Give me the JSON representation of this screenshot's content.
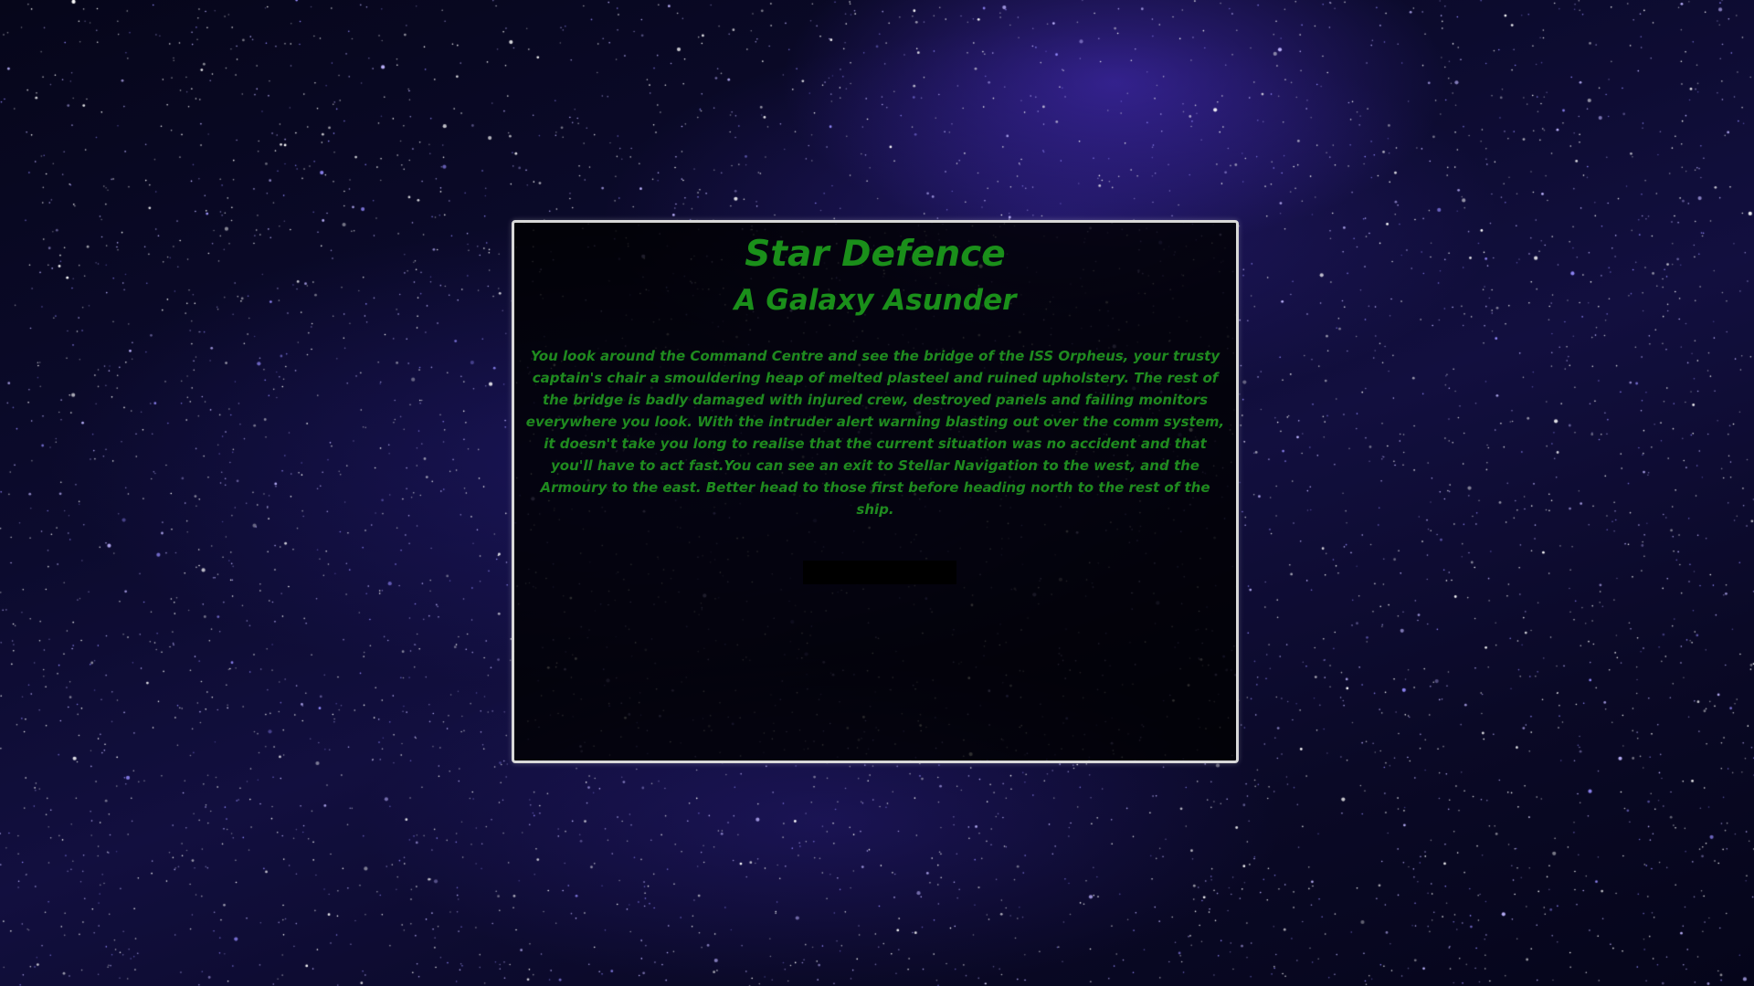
{
  "colors": {
    "accent_green": "#1a8f1a",
    "panel_border": "#d8d8d8",
    "background": "#0c0b2e"
  },
  "game": {
    "title": "Star Defence",
    "subtitle": "A Galaxy Asunder",
    "story": "You look around the Command Centre and see the bridge of the ISS Orpheus, your trusty captain's chair a smouldering heap of melted plasteel and ruined upholstery. The rest of the bridge is badly damaged with injured crew, destroyed panels and failing monitors everywhere you look. With the intruder alert warning blasting out over the comm system, it doesn't take you long to realise that the current situation was no accident and that you'll have to act fast.You can see an exit to Stellar Navigation to the west, and the Armoury to the east. Better head to those first before heading north to the rest of the ship.",
    "action_input_value": ""
  }
}
